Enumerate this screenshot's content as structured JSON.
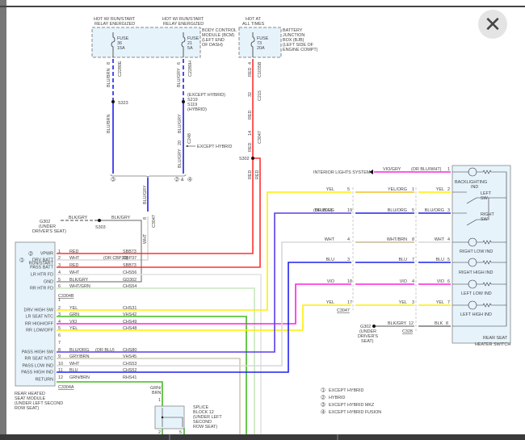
{
  "close_icon": "close-icon",
  "bcm": {
    "hot1": [
      "HOT W/ RUN/START",
      "RELAY ENERGIZED"
    ],
    "hot2": [
      "HOT W/ RUN/START",
      "RELAY ENERGIZED"
    ],
    "fuse36": [
      "FUSE",
      "36",
      "15A"
    ],
    "fuse21": [
      "FUSE",
      "21",
      "5A"
    ],
    "name": [
      "BODY CONTROL",
      "MODULE (BCM)",
      "(LEFT END",
      "OF DASH)"
    ]
  },
  "bjb": {
    "hot": [
      "HOT AT",
      "ALL TIMES"
    ],
    "fuse": [
      "FUSE",
      "73",
      "20A"
    ],
    "name": [
      "BATTERY",
      "JUNCTION",
      "BOX (BJB)",
      "(LEFT SIDE OF",
      "ENGINE COMPT)"
    ]
  },
  "upper": {
    "w36": "BLU/BRN",
    "p36": "8",
    "c36": "C2280E",
    "w21": "BLU/GRY",
    "p21": "6",
    "c21": "C2280H",
    "wred": "RED",
    "pred": "4",
    "cred": "C1035B",
    "s323": "S323",
    "s219": [
      "(EXCEPT HYBRID)",
      "S219",
      "S119",
      "(HYBRID)"
    ],
    "w36b": "BLU/BRN",
    "w21b": "BLU/GRY",
    "p21b": "20",
    "c21b": "C248",
    "w21c": "BLU/GRY",
    "except_hybrid": "EXCEPT HYBRID",
    "red_pin1": "32",
    "red_c1": "C215",
    "red_w1": "RED",
    "red_pin2": "14",
    "red_c2": "C3047",
    "red_w2": "RED",
    "s302": "S302",
    "red_w3": "RED",
    "red_w4": "RED",
    "note3": "3",
    "note24": "2",
    "amp": "&",
    "note4": "4",
    "wjoin": "BLU/GRY",
    "pjoin": "8",
    "cjoin": "C3047",
    "wwht": "WHT",
    "g302": [
      "G302",
      "(UNDER",
      "DRIVER'S SEAT)"
    ],
    "blkgry1": "BLK/GRY",
    "s303": "S303",
    "blkgry2": "BLK/GRY"
  },
  "module": {
    "pins_b": [
      {
        "label": "VPWR",
        "note": "2",
        "pin": "1",
        "wire": "RED",
        "circuit": "SBB73",
        "extra": ""
      },
      {
        "label": "DRV BATT",
        "note": "1",
        "pin": "2",
        "wire": "WHT",
        "circuit": "CBP37",
        "extra": "(OR CBP36)"
      },
      {
        "label": "RUN/START",
        "note": "",
        "pin": "",
        "wire": "",
        "circuit": "",
        "extra": ""
      },
      {
        "label": "PASS BATT",
        "note": "",
        "pin": "3",
        "wire": "RED",
        "circuit": "SBB73",
        "extra": ""
      },
      {
        "label": "LR HTR FD",
        "note": "",
        "pin": "4",
        "wire": "WHT",
        "circuit": "CHS56",
        "extra": ""
      },
      {
        "label": "GND",
        "note": "",
        "pin": "5",
        "wire": "BLK/GRY",
        "circuit": "GD302",
        "extra": ""
      },
      {
        "label": "RR HTR FD",
        "note": "",
        "pin": "6",
        "wire": "WHT/GRN",
        "circuit": "CHS54",
        "extra": ""
      }
    ],
    "conn_b": "C3304B",
    "pins_a": [
      {
        "label": "",
        "pin": "1",
        "wire": "",
        "circuit": "",
        "extra": ""
      },
      {
        "label": "DRV HIGH SW",
        "pin": "2",
        "wire": "YEL",
        "circuit": "CHS31",
        "extra": ""
      },
      {
        "label": "LR SEAT NTC",
        "pin": "3",
        "wire": "GRN",
        "circuit": "VHS42",
        "extra": ""
      },
      {
        "label": "RR HIGH/OFF",
        "pin": "4",
        "wire": "VIO",
        "circuit": "CHS49",
        "extra": ""
      },
      {
        "label": "RR LOW/OFF",
        "pin": "5",
        "wire": "YEL",
        "circuit": "CHS48",
        "extra": ""
      },
      {
        "label": "",
        "pin": "6",
        "wire": "",
        "circuit": "",
        "extra": ""
      },
      {
        "label": "",
        "pin": "7",
        "wire": "",
        "circuit": "",
        "extra": ""
      },
      {
        "label": "PASS HIGH SW",
        "pin": "8",
        "wire": "BLU/ORG",
        "circuit": "CHS80",
        "extra": "(OR BLU)"
      },
      {
        "label": "RR SEAT NTC",
        "pin": "9",
        "wire": "GRY/BRN",
        "circuit": "VHS45",
        "extra": ""
      },
      {
        "label": "PASS LOW IND",
        "pin": "10",
        "wire": "WHT",
        "circuit": "CHS53",
        "extra": ""
      },
      {
        "label": "PASS HIGH IND",
        "pin": "11",
        "wire": "BLU",
        "circuit": "CHS52",
        "extra": ""
      },
      {
        "label": "RETURN",
        "pin": "12",
        "wire": "GRN/BRN",
        "circuit": "RHS41",
        "extra": ""
      }
    ],
    "conn_a": "C3304A",
    "name": [
      "REAR HEATED",
      "SEAT MODULE",
      "(UNDER LEFT SECOND",
      "ROW SEAT)"
    ]
  },
  "right": {
    "interior": "INTERIOR LIGHTS SYSTEM",
    "vio_gry": "VIO/GRY",
    "vio_alt": "(OR BLU/WHT)",
    "vio_pin": "1",
    "rows": [
      {
        "w1": "YEL",
        "p1": "5",
        "w2": "YEL/ORG",
        "p2": "1",
        "w3": "YEL",
        "p3": "2",
        "alt": ""
      },
      {
        "w1": "BLU/ORG",
        "p1": "19",
        "w2": "BLU/ORG",
        "p2": "5",
        "w3": "BLU/ORG",
        "p3": "3",
        "alt": "(OR BLU)"
      },
      {
        "w1": "WHT",
        "p1": "4",
        "w2": "WHT/BRN",
        "p2": "8",
        "w3": "WHT",
        "p3": "4",
        "alt": ""
      },
      {
        "w1": "BLU",
        "p1": "3",
        "w2": "BLU",
        "p2": "7",
        "w3": "BLU",
        "p3": "5",
        "alt": ""
      },
      {
        "w1": "VIO",
        "p1": "18",
        "w2": "VIO",
        "p2": "4",
        "w3": "VIO",
        "p3": "6",
        "alt": ""
      },
      {
        "w1": "YEL",
        "p1": "17",
        "w2": "YEL",
        "p2": "3",
        "w3": "YEL",
        "p3": "7",
        "alt": ""
      }
    ],
    "c3047": "C3047",
    "g302": [
      "G302",
      "(UNDER",
      "DRIVER'S",
      "SEAT)"
    ],
    "gnd_w2": "BLK/GRY",
    "gnd_p2": "12",
    "c328": "C328",
    "gnd_w3": "BLK",
    "gnd_p3": "8",
    "switch": {
      "backlight": [
        "BACKLIGHTING",
        "IND"
      ],
      "left_sw": [
        "LEFT",
        "SW"
      ],
      "right_sw": [
        "RIGHT",
        "SW"
      ],
      "right_low": "RIGHT LOW IND",
      "right_high": "RIGHT HIGH IND",
      "left_low": "LEFT LOW IND",
      "left_high": "LEFT HIGH IND",
      "name": [
        "REAR SEAT",
        "HEATER SWITCH"
      ]
    }
  },
  "splice": {
    "w": [
      "GRN/",
      "BRN"
    ],
    "pin_in": "1",
    "pin2": "2",
    "pin5": "5",
    "name": [
      "SPLICE",
      "BLOCK 12",
      "(UNDER LEFT",
      "SECOND",
      "ROW SEAT)"
    ]
  },
  "legend": [
    {
      "n": "1",
      "t": "EXCEPT HYBRID"
    },
    {
      "n": "2",
      "t": "HYBRID"
    },
    {
      "n": "3",
      "t": "EXCEPT HYBRID MKZ"
    },
    {
      "n": "4",
      "t": "EXCEPT HYBRID FUSION"
    }
  ],
  "colors": {
    "red": "#ff3030",
    "blue": "#2020ee",
    "yellow": "#ffee00",
    "violet": "#ff20e0",
    "green": "#44bb22",
    "white_wire": "#d8d8d8",
    "box": "#e6f3fb"
  }
}
